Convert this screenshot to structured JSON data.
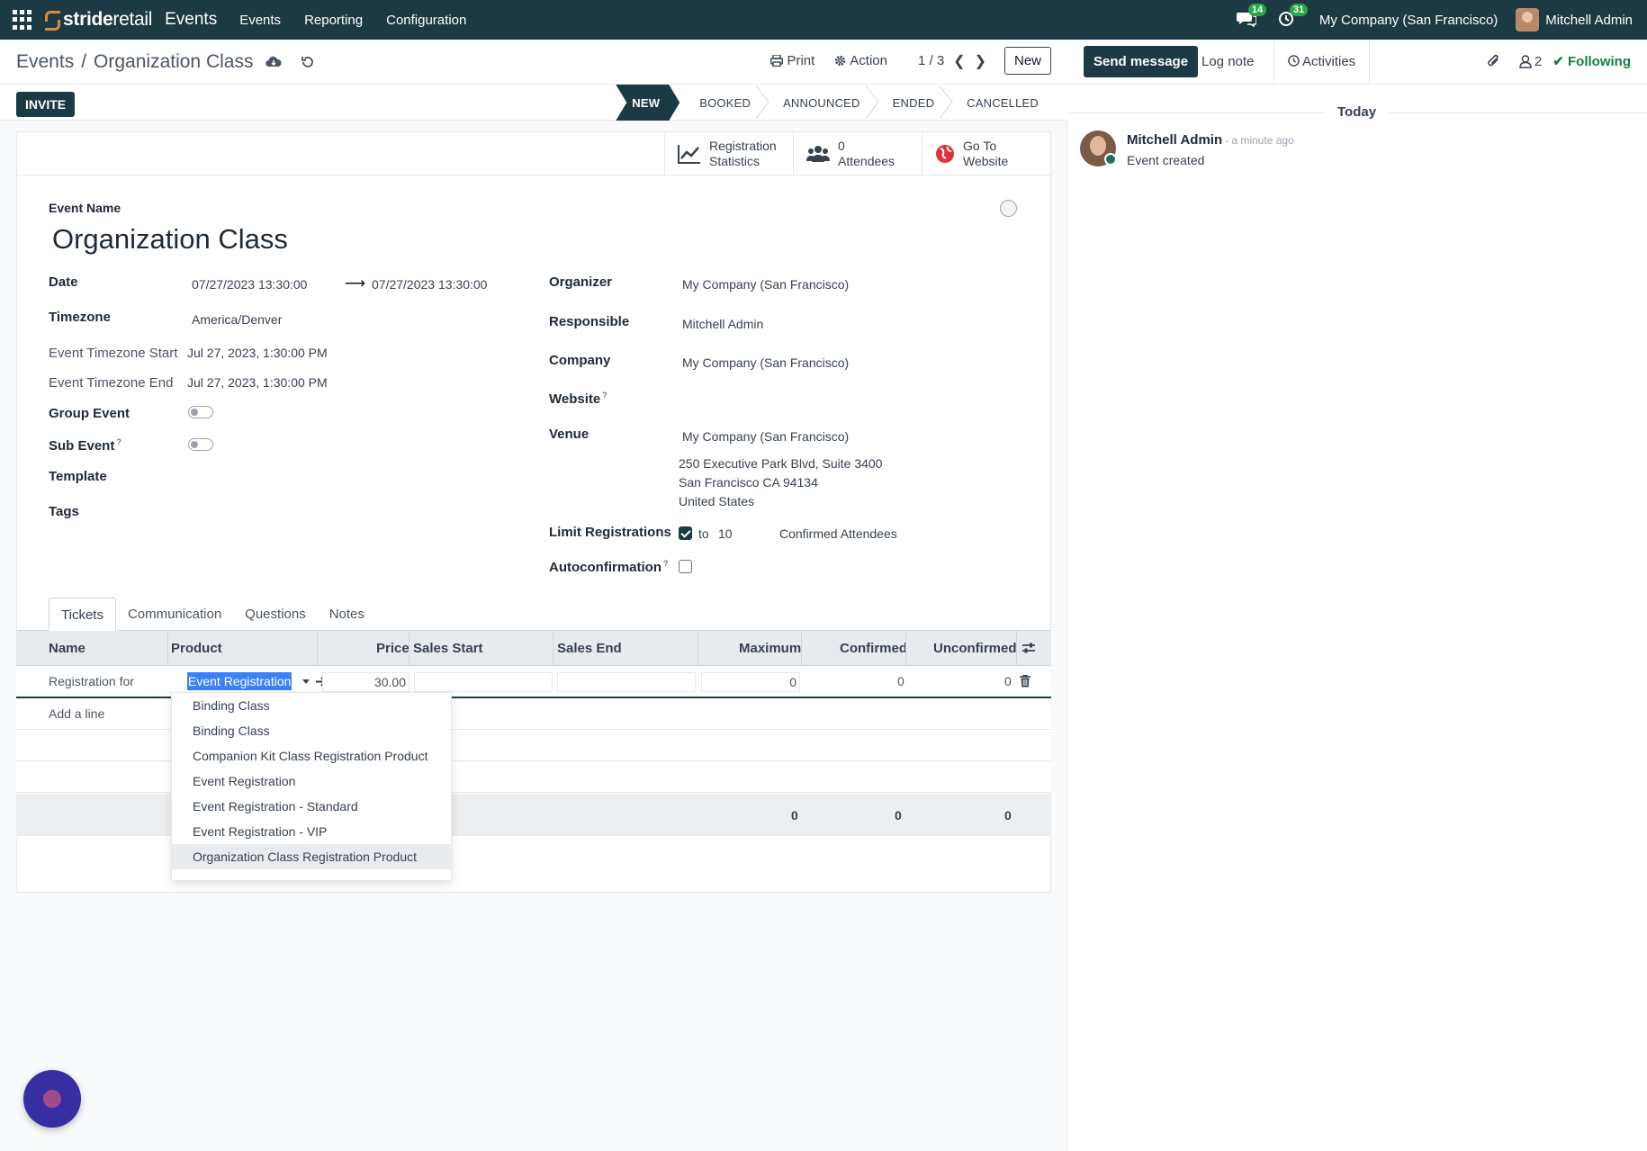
{
  "navbar": {
    "brand_prefix": "stride",
    "brand_suffix": "retail",
    "app_name": "Events",
    "menu": [
      "Events",
      "Reporting",
      "Configuration"
    ],
    "messages_count": "14",
    "activities_count": "31",
    "company": "My Company (San Francisco)",
    "user": "Mitchell Admin"
  },
  "control_panel": {
    "breadcrumb_parent": "Events",
    "breadcrumb_current": "Organization Class",
    "print_label": "Print",
    "action_label": "Action",
    "pager": "1 / 3",
    "new_label": "New"
  },
  "status_bar": {
    "invite_label": "INVITE",
    "stages": [
      "NEW",
      "BOOKED",
      "ANNOUNCED",
      "ENDED",
      "CANCELLED"
    ],
    "active_stage": "NEW"
  },
  "smart_buttons": {
    "registration_stats_line1": "Registration",
    "registration_stats_line2": "Statistics",
    "attendees_count": "0",
    "attendees_label": "Attendees",
    "website_line1": "Go To",
    "website_line2": "Website"
  },
  "form": {
    "event_name_label": "Event Name",
    "event_name": "Organization Class",
    "date_label": "Date",
    "date_start": "07/27/2023 13:30:00",
    "date_end": "07/27/2023 13:30:00",
    "timezone_label": "Timezone",
    "timezone": "America/Denver",
    "tz_start_label": "Event Timezone Start",
    "tz_start": "Jul 27, 2023, 1:30:00 PM",
    "tz_end_label": "Event Timezone End",
    "tz_end": "Jul 27, 2023, 1:30:00 PM",
    "group_event_label": "Group Event",
    "sub_event_label": "Sub Event",
    "template_label": "Template",
    "tags_label": "Tags",
    "organizer_label": "Organizer",
    "organizer": "My Company (San Francisco)",
    "responsible_label": "Responsible",
    "responsible": "Mitchell Admin",
    "company_label": "Company",
    "company": "My Company (San Francisco)",
    "website_label": "Website",
    "venue_label": "Venue",
    "venue": "My Company (San Francisco)",
    "venue_address_1": "250 Executive Park Blvd, Suite 3400",
    "venue_address_2": "San Francisco CA 94134",
    "venue_address_3": "United States",
    "limit_label": "Limit Registrations",
    "limit_to": "to",
    "limit_value": "10",
    "limit_suffix": "Confirmed Attendees",
    "autoconfirm_label": "Autoconfirmation"
  },
  "tabs": [
    "Tickets",
    "Communication",
    "Questions",
    "Notes"
  ],
  "tickets_table": {
    "columns": [
      "Name",
      "Product",
      "Price",
      "Sales Start",
      "Sales End",
      "Maximum",
      "Confirmed",
      "Unconfirmed"
    ],
    "row": {
      "name": "Registration for",
      "product": "Event Registration",
      "price": "30.00",
      "maximum": "0",
      "confirmed": "0",
      "unconfirmed": "0"
    },
    "add_line": "Add a line",
    "totals": {
      "maximum": "0",
      "confirmed": "0",
      "unconfirmed": "0"
    }
  },
  "product_dropdown": [
    "Binding Class",
    "Binding Class",
    "Companion Kit Class Registration Product",
    "Event Registration",
    "Event Registration - Standard",
    "Event Registration - VIP",
    "Organization Class Registration Product"
  ],
  "chatter": {
    "send_message": "Send message",
    "log_note": "Log note",
    "activities": "Activities",
    "followers_count": "2",
    "following": "Following",
    "day": "Today",
    "message_author": "Mitchell Admin",
    "message_time": "- a minute ago",
    "message_body": "Event created"
  },
  "colors": {
    "brand_dark": "#1c3a43",
    "accent_orange": "#e0883a",
    "badge_green": "#28a745",
    "following_green": "#15803d",
    "selection_blue": "#3b82f6"
  }
}
